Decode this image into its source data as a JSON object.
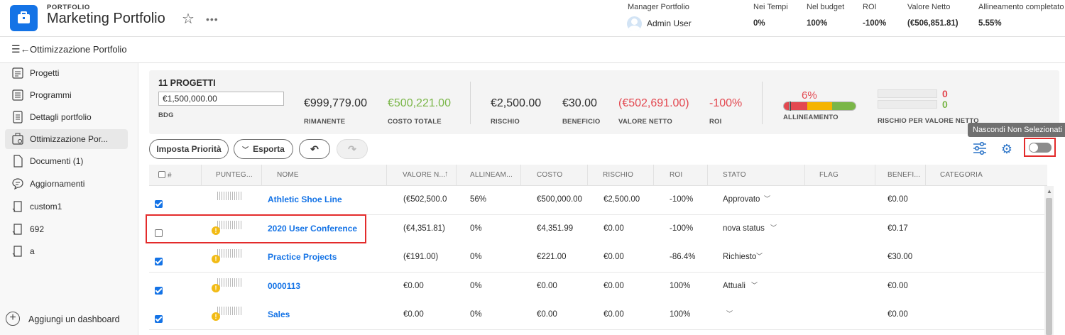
{
  "header": {
    "eyebrow": "PORTFOLIO",
    "title": "Marketing Portfolio",
    "star_icon": "star-icon",
    "more_icon": "more-icon",
    "kpis": [
      {
        "label": "Manager Portfolio",
        "value": "Admin User"
      },
      {
        "label": "Nei Tempi",
        "value": "0%"
      },
      {
        "label": "Nel budget",
        "value": "100%"
      },
      {
        "label": "ROI",
        "value": "-100%"
      },
      {
        "label": "Valore Netto",
        "value": "(€506,851.81)"
      },
      {
        "label": "Allineamento completato",
        "value": "5.55%"
      }
    ]
  },
  "section": {
    "title": "Ottimizzazione Portfolio"
  },
  "sidebar": {
    "items": [
      {
        "label": "Progetti",
        "icon": "projects-icon"
      },
      {
        "label": "Programmi",
        "icon": "programs-icon"
      },
      {
        "label": "Dettagli portfolio",
        "icon": "details-icon"
      },
      {
        "label": "Ottimizzazione Por...",
        "icon": "optimizer-icon",
        "active": true
      },
      {
        "label": "Documenti (1)",
        "icon": "document-icon"
      },
      {
        "label": "Aggiornamenti",
        "icon": "updates-icon"
      },
      {
        "label": "custom1",
        "icon": "custom-page-icon"
      },
      {
        "label": "692",
        "icon": "custom-page-icon"
      },
      {
        "label": "a",
        "icon": "custom-page-icon"
      }
    ],
    "add_dashboard": "Aggiungi un dashboard"
  },
  "summary": {
    "project_count": "11 PROGETTI",
    "budget_value": "€1,500,000.00",
    "budget_label": "BDG",
    "remaining": {
      "value": "€999,779.00",
      "label": "RIMANENTE"
    },
    "total_cost": {
      "value": "€500,221.00",
      "label": "COSTO TOTALE"
    },
    "risk": {
      "value": "€2,500.00",
      "label": "RISCHIO"
    },
    "benefit": {
      "value": "€30.00",
      "label": "BENEFICIO"
    },
    "net_value": {
      "value": "(€502,691.00)",
      "label": "VALORE NETTO"
    },
    "roi": {
      "value": "-100%",
      "label": "ROI"
    },
    "alignment": {
      "value": "6%",
      "label": "ALLINEAMENTO",
      "fraction": 0.06,
      "colors": [
        "#e34850",
        "#f5b400",
        "#7ab648"
      ]
    },
    "risk_value": {
      "label": "RISCHIO PER VALORE NETTO",
      "top": "0",
      "bottom": "0",
      "top_color": "#e34850",
      "bottom_color": "#7ab648"
    }
  },
  "toolbar": {
    "set_priority": "Imposta Priorità",
    "export": "Esporta",
    "undo_icon": "undo-icon",
    "redo_icon": "redo-icon",
    "filter_icon": "filter-sliders-icon",
    "settings_icon": "gear-icon",
    "toggle_tooltip": "Nascondi Non Selezionati",
    "toggle_on": false
  },
  "table": {
    "columns": [
      "#",
      "PUNTEG...",
      "NOME",
      "VALORE N...",
      "ALLINEAM...",
      "COSTO",
      "RISCHIO",
      "ROI",
      "STATO",
      "FLAG",
      "BENEFI...",
      "CATEGORIA"
    ],
    "rows": [
      {
        "checked": true,
        "warning": false,
        "name": "Athletic Shoe Line",
        "net_value": "(€502,500.0",
        "alignment": "56%",
        "cost": "€500,000.00",
        "risk": "€2,500.00",
        "roi": "-100%",
        "status": "Approvato",
        "flag": "",
        "benefit": "€0.00",
        "category": ""
      },
      {
        "checked": false,
        "warning": true,
        "name": "2020 User Conference",
        "net_value": "(€4,351.81)",
        "alignment": "0%",
        "cost": "€4,351.99",
        "risk": "€0.00",
        "roi": "-100%",
        "status": "nova status",
        "flag": "",
        "benefit": "€0.17",
        "category": ""
      },
      {
        "checked": true,
        "warning": true,
        "name": "Practice Projects",
        "net_value": "(€191.00)",
        "alignment": "0%",
        "cost": "€221.00",
        "risk": "€0.00",
        "roi": "-86.4%",
        "status": "Richiesto",
        "flag": "",
        "benefit": "€30.00",
        "category": ""
      },
      {
        "checked": true,
        "warning": true,
        "name": "0000113",
        "net_value": "€0.00",
        "alignment": "0%",
        "cost": "€0.00",
        "risk": "€0.00",
        "roi": "100%",
        "status": "Attuali",
        "flag": "",
        "benefit": "€0.00",
        "category": ""
      },
      {
        "checked": true,
        "warning": true,
        "name": "Sales",
        "net_value": "€0.00",
        "alignment": "0%",
        "cost": "€0.00",
        "risk": "€0.00",
        "roi": "100%",
        "status": "",
        "flag": "",
        "benefit": "€0.00",
        "category": ""
      }
    ]
  }
}
